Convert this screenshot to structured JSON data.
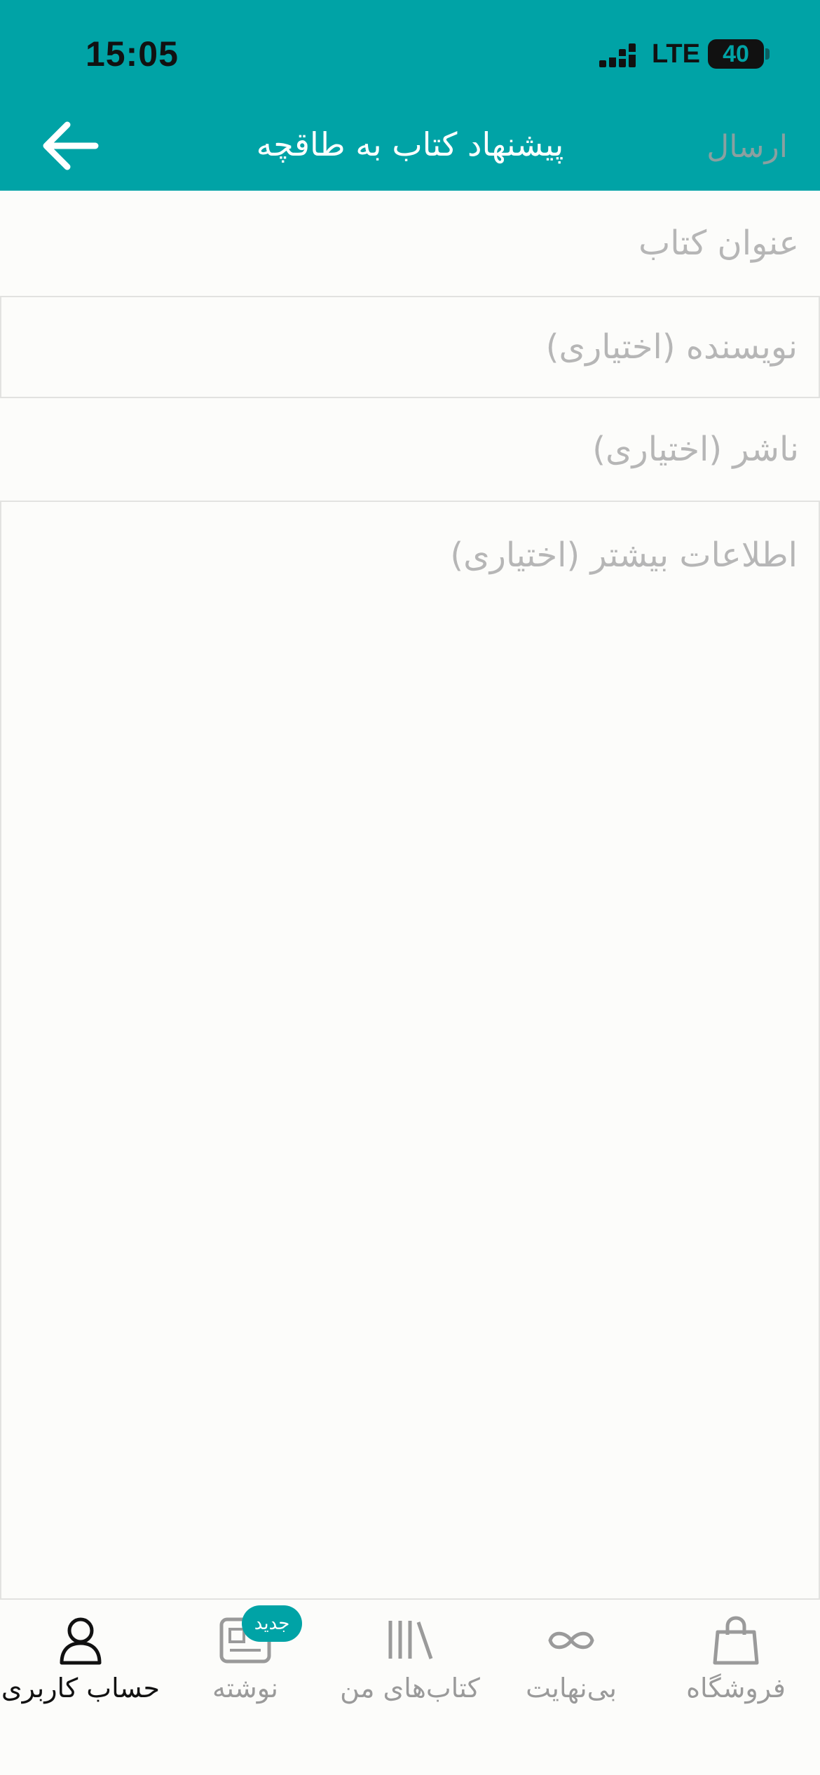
{
  "status_bar": {
    "time": "15:05",
    "network": "LTE",
    "battery": "40"
  },
  "header": {
    "title": "پیشنهاد کتاب به طاقچه",
    "send_label": "ارسال",
    "back_icon": "arrow-left-icon",
    "background_color": "#00a3a6"
  },
  "form": {
    "title_placeholder": "عنوان کتاب",
    "author_placeholder": "نویسنده (اختیاری)",
    "publisher_placeholder": "ناشر (اختیاری)",
    "info_placeholder": "اطلاعات بیشتر (اختیاری)"
  },
  "bottom_nav": {
    "account": {
      "label": "حساب کاربری",
      "icon": "user-icon"
    },
    "writing": {
      "label": "نوشته",
      "icon": "article-icon",
      "badge": "جدید"
    },
    "my_books": {
      "label": "کتاب‌های من",
      "icon": "bookshelf-icon"
    },
    "unlimited": {
      "label": "بی‌نهایت",
      "icon": "infinity-icon"
    },
    "store": {
      "label": "فروشگاه",
      "icon": "shopping-bag-icon"
    }
  }
}
